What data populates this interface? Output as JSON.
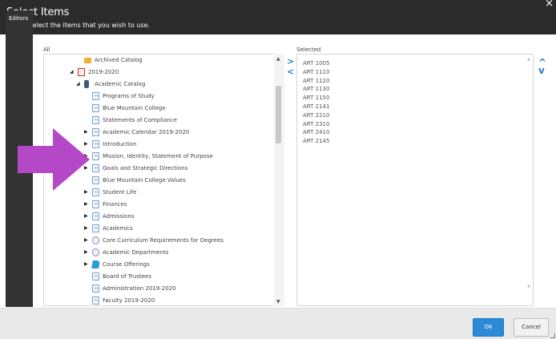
{
  "dialog": {
    "title": "Select Items",
    "subtitle": "Please select the items that you wish to use.",
    "close_glyph": "×"
  },
  "sidebar": {
    "tab_label": "Editors"
  },
  "panels": {
    "all_label": "All",
    "selected_label": "Selected"
  },
  "tree": [
    {
      "label": "Archived Catalog",
      "icon": "folder-icon",
      "indent": 2,
      "expander": ""
    },
    {
      "label": "2019-2020",
      "icon": "calendar-icon",
      "indent": 1,
      "expander": "◢"
    },
    {
      "label": "Academic Catalog",
      "icon": "catalog-icon",
      "indent": 2,
      "expander": "◢"
    },
    {
      "label": "Programs of Study",
      "icon": "page-icon",
      "indent": 3,
      "expander": ""
    },
    {
      "label": "Blue Mountain College",
      "icon": "page-icon",
      "indent": 3,
      "expander": ""
    },
    {
      "label": "Statements of Compliance",
      "icon": "page-icon",
      "indent": 3,
      "expander": ""
    },
    {
      "label": "Academic Calendar 2019-2020",
      "icon": "page-icon",
      "indent": 3,
      "expander": "▶"
    },
    {
      "label": "Introduction",
      "icon": "page-icon",
      "indent": 3,
      "expander": "▶"
    },
    {
      "label": "Mission, Identity, Statement of Purpose",
      "icon": "page-icon",
      "indent": 3,
      "expander": "▶"
    },
    {
      "label": "Goals and Strategic Directions",
      "icon": "page-icon",
      "indent": 3,
      "expander": "▶"
    },
    {
      "label": "Blue Mountain College Values",
      "icon": "page-icon",
      "indent": 3,
      "expander": ""
    },
    {
      "label": "Student Life",
      "icon": "page-icon",
      "indent": 3,
      "expander": "▶"
    },
    {
      "label": "Finances",
      "icon": "page-icon",
      "indent": 3,
      "expander": "▶"
    },
    {
      "label": "Admissions",
      "icon": "page-icon",
      "indent": 3,
      "expander": "▶"
    },
    {
      "label": "Academics",
      "icon": "page-icon",
      "indent": 3,
      "expander": "▶"
    },
    {
      "label": "Core Curriculum Requirements for Degrees",
      "icon": "settings-icon",
      "indent": 3,
      "expander": "▶"
    },
    {
      "label": "Academic Departments",
      "icon": "settings-icon",
      "indent": 3,
      "expander": "▶"
    },
    {
      "label": "Course Offerings",
      "icon": "courses-icon",
      "indent": 3,
      "expander": "▶"
    },
    {
      "label": "Board of Trustees",
      "icon": "page-icon",
      "indent": 3,
      "expander": ""
    },
    {
      "label": "Administration 2019-2020",
      "icon": "page-icon",
      "indent": 3,
      "expander": ""
    },
    {
      "label": "Faculty 2019-2020",
      "icon": "page-icon",
      "indent": 3,
      "expander": ""
    }
  ],
  "selected_items": [
    "ART 1005",
    "ART 1110",
    "ART 1120",
    "ART 1130",
    "ART 1150",
    "ART 2141",
    "ART 2210",
    "ART 2310",
    "ART 2410",
    "ART 2145"
  ],
  "controls": {
    "add_glyph": ">",
    "remove_glyph": "<",
    "move_up_glyph": "^",
    "move_down_glyph": "v"
  },
  "buttons": {
    "ok": "OK",
    "cancel": "Cancel"
  },
  "colors": {
    "accent": "#2c8ad6",
    "header_bg": "#2b2b2b",
    "annotation_arrow": "#b548c6"
  }
}
